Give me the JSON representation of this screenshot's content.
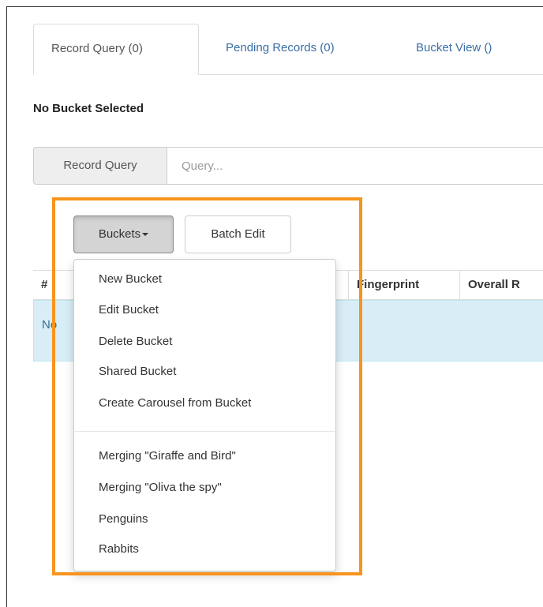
{
  "tabs": [
    {
      "label": "Record Query (0)",
      "active": true
    },
    {
      "label": "Pending Records (0)",
      "active": false
    },
    {
      "label": "Bucket View ()",
      "active": false
    }
  ],
  "bucket_status": "No Bucket Selected",
  "query": {
    "addon_label": "Record Query",
    "placeholder": "Query...",
    "value": ""
  },
  "toolbar": {
    "buckets_label": "Buckets",
    "batch_edit_label": "Batch Edit"
  },
  "table": {
    "headers": [
      "#",
      "Fingerprint",
      "Overall R"
    ],
    "empty_message": "No"
  },
  "buckets_menu": {
    "actions": [
      "New Bucket",
      "Edit Bucket",
      "Delete Bucket",
      "Shared Bucket",
      "Create Carousel from Bucket"
    ],
    "buckets": [
      "Merging \"Giraffe and Bird\"",
      "Merging \"Oliva the spy\"",
      "Penguins",
      "Rabbits"
    ]
  },
  "colors": {
    "highlight": "#f7941d",
    "link": "#3a6ea5",
    "info_bg": "#d9edf7"
  }
}
